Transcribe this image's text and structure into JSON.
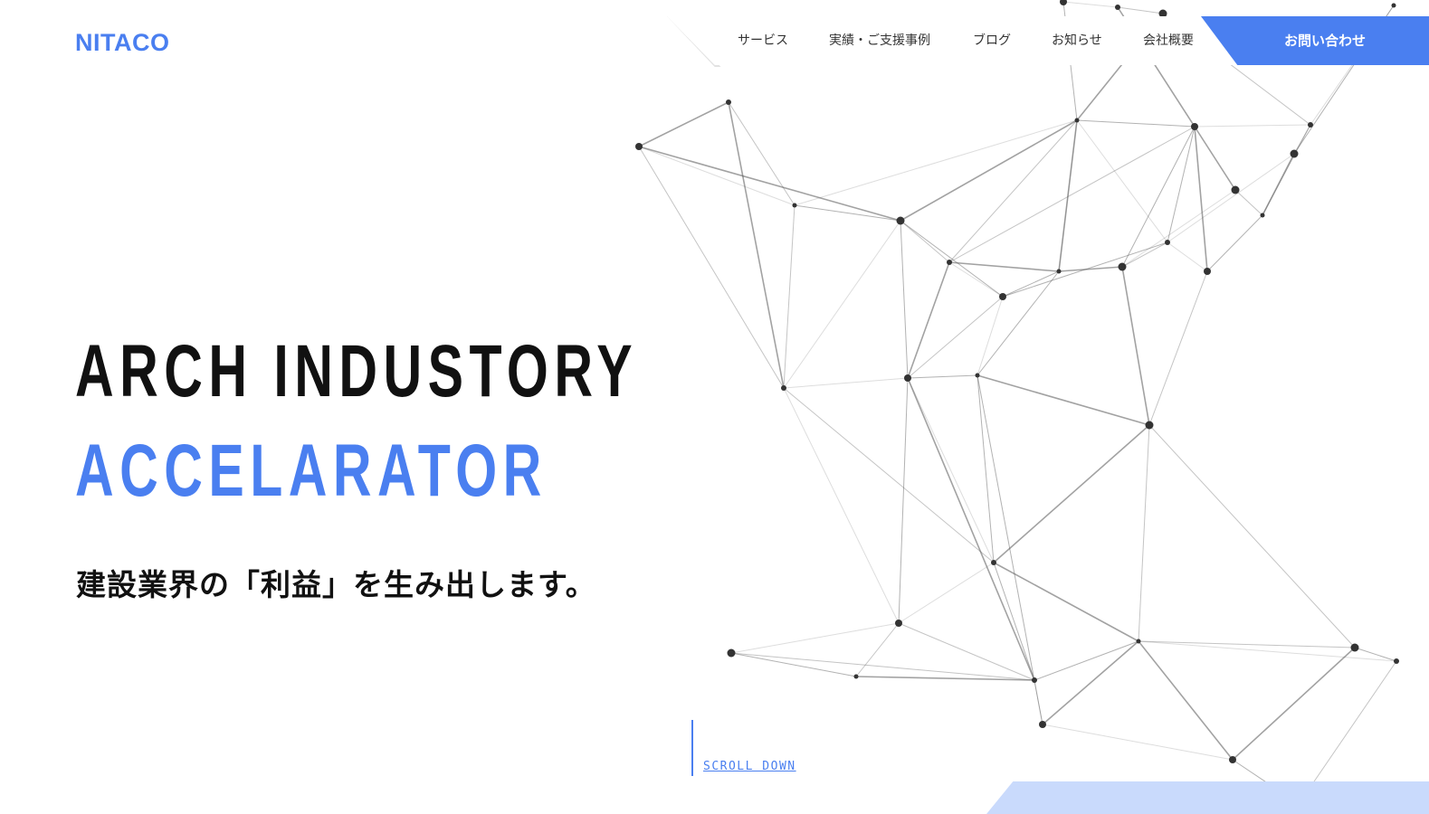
{
  "brand": {
    "logo": "NITACO",
    "accent": "#4a7ff0"
  },
  "nav": {
    "items": [
      {
        "label": "サービス"
      },
      {
        "label": "実績・ご支援事例"
      },
      {
        "label": "ブログ"
      },
      {
        "label": "お知らせ"
      },
      {
        "label": "会社概要"
      }
    ],
    "cta_label": "お問い合わせ"
  },
  "hero": {
    "headline_1": "ARCH INDUSTORY",
    "headline_2": "ACCELARATOR",
    "tagline": "建設業界の「利益」を生み出します。",
    "scroll_label": "SCROLL DOWN"
  },
  "colors": {
    "accent": "#4a7ff0",
    "text": "#111111",
    "band": "#c9dafc"
  }
}
